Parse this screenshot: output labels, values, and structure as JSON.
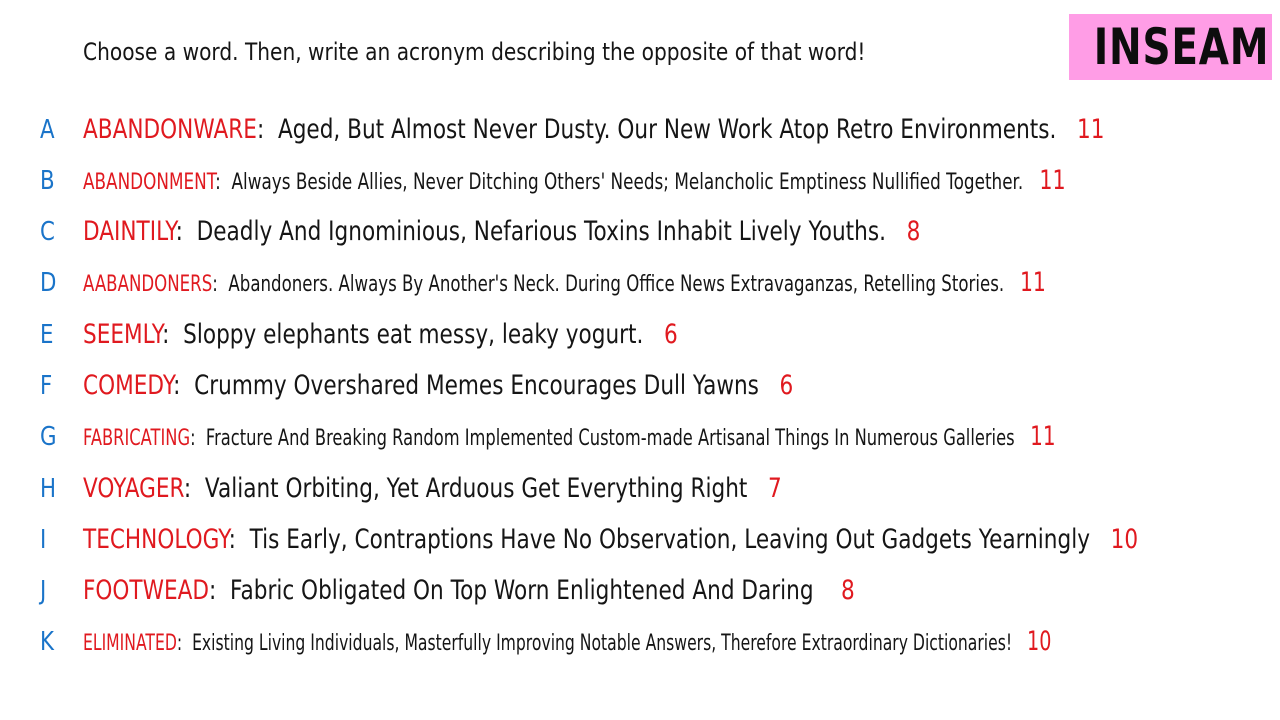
{
  "prompt": "Choose a word. Then, write an acronym describing the opposite of that word!",
  "logo": "INSEAM",
  "colors": {
    "letter": "#1a74c9",
    "word": "#e0191f",
    "text": "#151515",
    "logo_bg": "#ff9de6"
  },
  "entries": [
    {
      "letter": "A",
      "word": "ABANDONWARE",
      "acronym": "Aged, But Almost Never Dusty. Our New Work Atop Retro Environments.",
      "count": "11"
    },
    {
      "letter": "B",
      "word": "ABANDONMENT",
      "acronym": "Always Beside Allies, Never Ditching Others' Needs; Melancholic Emptiness Nullified Together.",
      "count": "11"
    },
    {
      "letter": "C",
      "word": "DAINTILY",
      "acronym": "Deadly And Ignominious, Nefarious Toxins Inhabit Lively Youths.",
      "count": "8"
    },
    {
      "letter": "D",
      "word": "AABANDONERS",
      "acronym": "Abandoners. Always By Another's Neck. During Office News Extravaganzas, Retelling Stories.",
      "count": "11"
    },
    {
      "letter": "E",
      "word": "SEEMLY",
      "acronym": "Sloppy elephants eat messy, leaky yogurt.",
      "count": "6"
    },
    {
      "letter": "F",
      "word": "COMEDY",
      "acronym": "Crummy Overshared Memes Encourages Dull Yawns",
      "count": "6"
    },
    {
      "letter": "G",
      "word": "FABRICATING",
      "acronym": "Fracture And Breaking Random Implemented Custom-made Artisanal Things In Numerous Galleries",
      "count": "11"
    },
    {
      "letter": "H",
      "word": "VOYAGER",
      "acronym": "Valiant Orbiting, Yet Arduous Get Everything Right",
      "count": "7"
    },
    {
      "letter": "I",
      "word": "TECHNOLOGY",
      "acronym": "Tis Early, Contraptions Have No Observation, Leaving Out Gadgets Yearningly",
      "count": "10"
    },
    {
      "letter": "J",
      "word": "FOOTWEAD",
      "acronym": "Fabric Obligated On Top Worn Enlightened And Daring",
      "count": "8"
    },
    {
      "letter": "K",
      "word": "ELIMINATED",
      "acronym": "Existing Living Individuals, Masterfully Improving Notable Answers, Therefore Extraordinary Dictionaries!",
      "count": "10"
    }
  ]
}
